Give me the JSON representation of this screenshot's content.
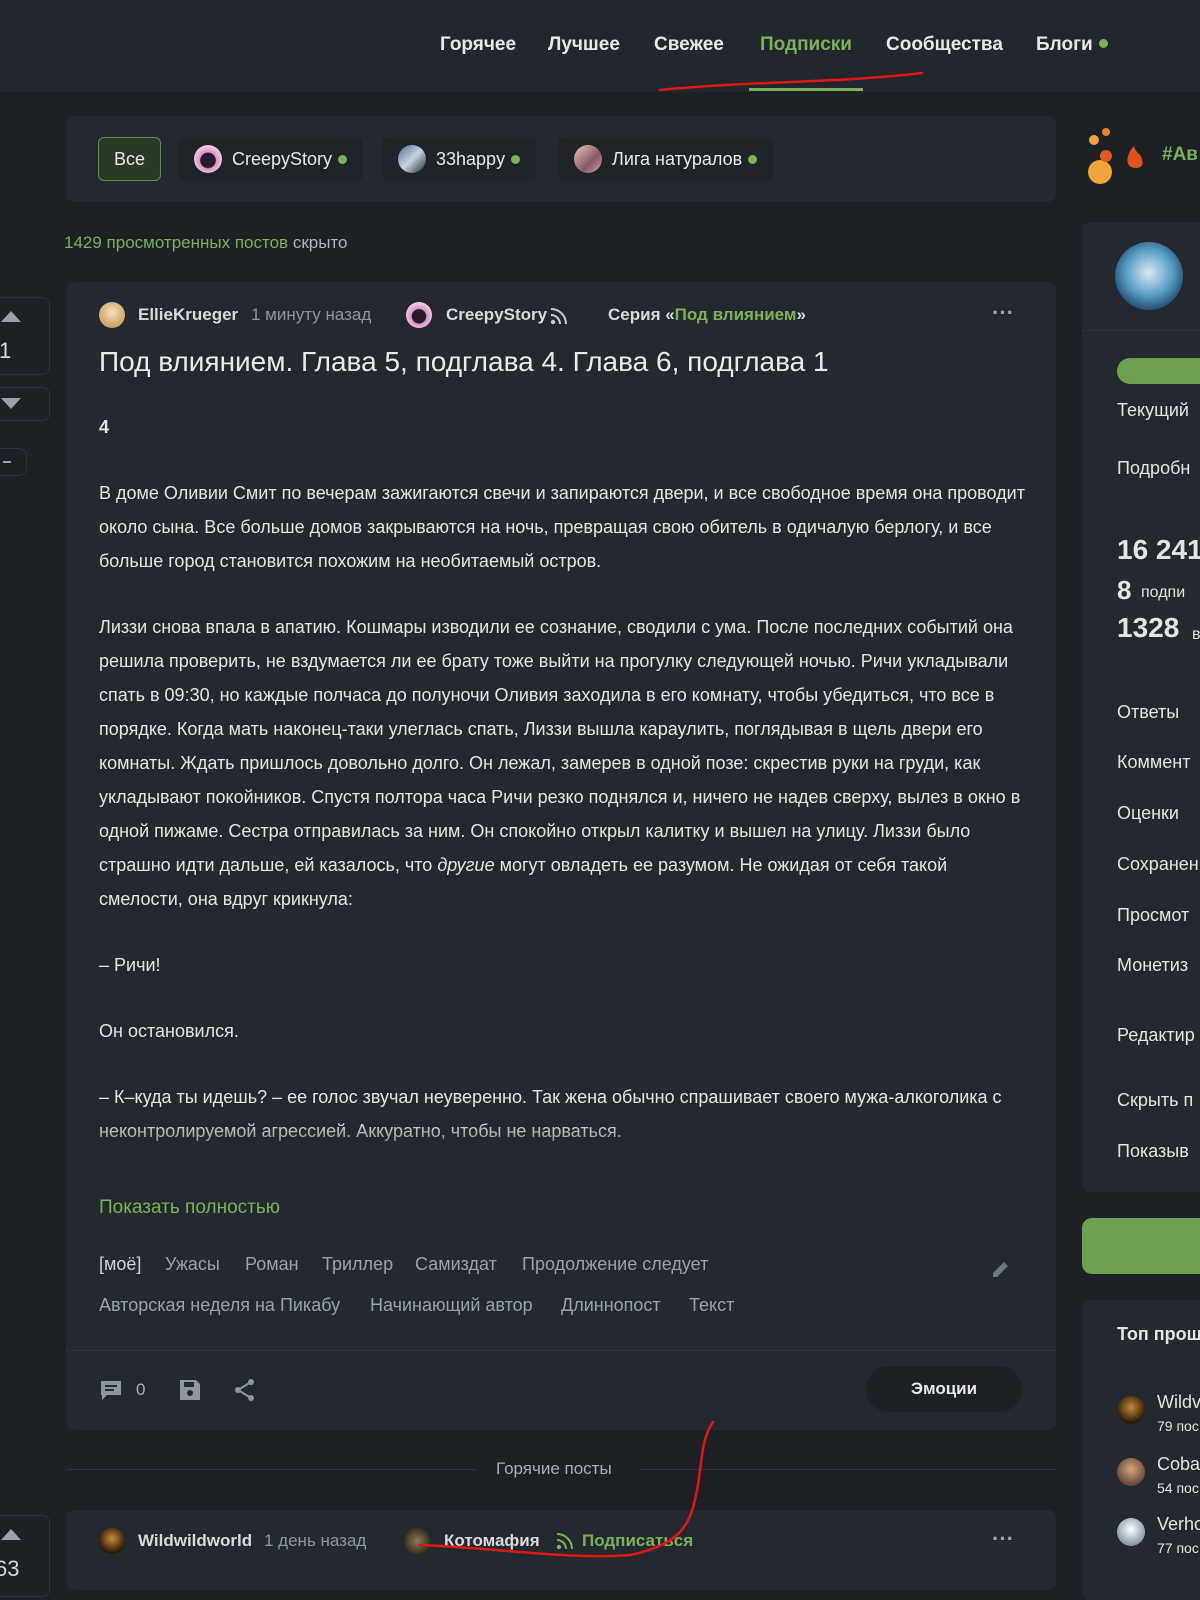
{
  "nav": {
    "items": [
      {
        "label": "Горячее"
      },
      {
        "label": "Лучшее"
      },
      {
        "label": "Свежее"
      },
      {
        "label": "Подписки"
      },
      {
        "label": "Сообщества"
      },
      {
        "label": "Блоги"
      }
    ],
    "active": "Подписки"
  },
  "filters": {
    "all": "Все",
    "chips": [
      {
        "label": "CreepyStory"
      },
      {
        "label": "33happy"
      },
      {
        "label": "Лига натуралов"
      }
    ]
  },
  "hidden_note": {
    "link": "1429 просмотренных постов",
    "suffix": " скрыто"
  },
  "votes": {
    "post1_rating": "1",
    "post2_rating": "63"
  },
  "post": {
    "author": "EllieKrueger",
    "time": "1 минуту назад",
    "community": "CreepyStory",
    "series_prefix": "Серия «",
    "series_name": "Под влиянием",
    "series_suffix": "»",
    "more": "···",
    "title": "Под влиянием. Глава 5, подглава 4. Глава 6, подглава 1",
    "section_number": "4",
    "p1": "В доме Оливии Смит по вечерам зажигаются свечи и запираются двери, и все свободное время она проводит около сына. Все больше домов закрываются на ночь, превращая свою обитель в одичалую берлогу, и все больше город становится похожим на необитаемый остров.",
    "p2_a": "Лиззи снова впала в апатию. Кошмары изводили ее сознание, сводили с ума. После последних событий она решила проверить, не вздумается ли ее брату тоже выйти на прогулку следующей ночью. Ричи укладывали спать в 09:30, но каждые полчаса до полуночи Оливия заходила в его комнату, чтобы убедиться, что все в порядке. Когда мать наконец-таки улеглась спать, Лиззи вышла караулить, поглядывая в щель двери его комнаты. Ждать пришлось довольно долго. Он лежал, замерев в одной позе: скрестив руки на груди, как укладывают покойников. Спустя полтора часа Ричи резко поднялся и, ничего не надев сверху, вылез в окно в одной пижаме. Сестра отправилась за ним. Он спокойно открыл калитку и вышел на улицу. Лиззи было страшно идти дальше, ей казалось, что ",
    "p2_em": "другие",
    "p2_b": " могут овладеть ее разумом. Не ожидая от себя такой смелости, она вдруг крикнула:",
    "p3": "– Ричи!",
    "p4": "Он остановился.",
    "p5": "– К–куда ты идешь? – ее голос звучал неуверенно. Так жена обычно спрашивает своего мужа-алкоголика с неконтролируемой агрессией. Аккуратно, чтобы не нарваться.",
    "show_full": "Показать полностью",
    "tags_row1": [
      "[моё]",
      "Ужасы",
      "Роман",
      "Триллер",
      "Самиздат",
      "Продолжение следует"
    ],
    "tags_row2": [
      "Авторская неделя на Пикабу",
      "Начинающий автор",
      "Длиннопост",
      "Текст"
    ],
    "comments_count": "0",
    "emotions_label": "Эмоции"
  },
  "hot_posts_label": "Горячие посты",
  "post2": {
    "author": "Wildwildworld",
    "time": "1 день назад",
    "community": "Котомафия",
    "subscribe": "Подписаться",
    "more": "···"
  },
  "sidebar": {
    "hashtag_partial": "#Ав",
    "current_partial": "Текущий",
    "details_partial": "Подробн",
    "stat1": "16 241",
    "stat2_num": "8",
    "stat2_label_partial": "подпи",
    "stat3_num": "1328",
    "stat3_label_partial": "в",
    "menu": [
      "Ответы",
      "Коммент",
      "Оценки",
      "Сохранен",
      "Просмот",
      "Монетиз"
    ],
    "edit_partial": "Редактир",
    "hide_partial": "Скрыть п",
    "show_partial": "Показыв",
    "top_title_partial": "Топ прош",
    "top_users": [
      {
        "name": "Wildv",
        "sub": "79 пос"
      },
      {
        "name": "Coba",
        "sub": "54 пос"
      },
      {
        "name": "Verho",
        "sub": "77 пос"
      }
    ]
  },
  "colors": {
    "accent": "#7cb05a",
    "background": "#1d2126",
    "card": "#24292f",
    "annotation": "#e01818"
  }
}
